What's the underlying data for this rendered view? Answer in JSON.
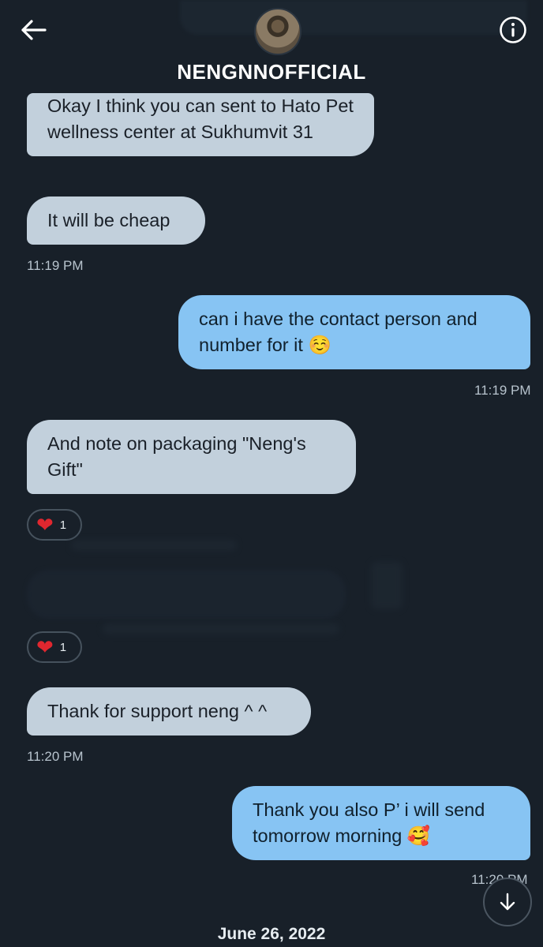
{
  "header": {
    "username": "NENGNNOFFICIAL",
    "back_icon": "arrow-left-icon",
    "info_icon": "info-icon"
  },
  "messages": [
    {
      "side": "received",
      "text": "Okay I think you can sent to Hato Pet wellness center at Sukhumvit 31"
    },
    {
      "side": "received",
      "text": "It will be cheap",
      "time": "11:19 PM"
    },
    {
      "side": "sent",
      "text": "can i have the contact person and number for it ☺️",
      "time": "11:19 PM"
    },
    {
      "side": "received",
      "text": "And note on packaging \"Neng's Gift\"",
      "reaction": {
        "emoji": "❤",
        "count": "1"
      }
    },
    {
      "side": "received",
      "text": "",
      "reaction": {
        "emoji": "❤",
        "count": "1"
      }
    },
    {
      "side": "received",
      "text": "Thank for support neng ^ ^",
      "time": "11:20 PM"
    },
    {
      "side": "sent",
      "text": "Thank you also P’ i will send tomorrow morning 🥰",
      "time": "11:20 PM"
    }
  ],
  "footer": {
    "date": "June 26, 2022",
    "scroll_icon": "arrow-down-icon"
  },
  "colors": {
    "background": "#182029",
    "received_bubble": "#c2d0dc",
    "sent_bubble": "#87c4f3",
    "heart": "#e0272f"
  }
}
